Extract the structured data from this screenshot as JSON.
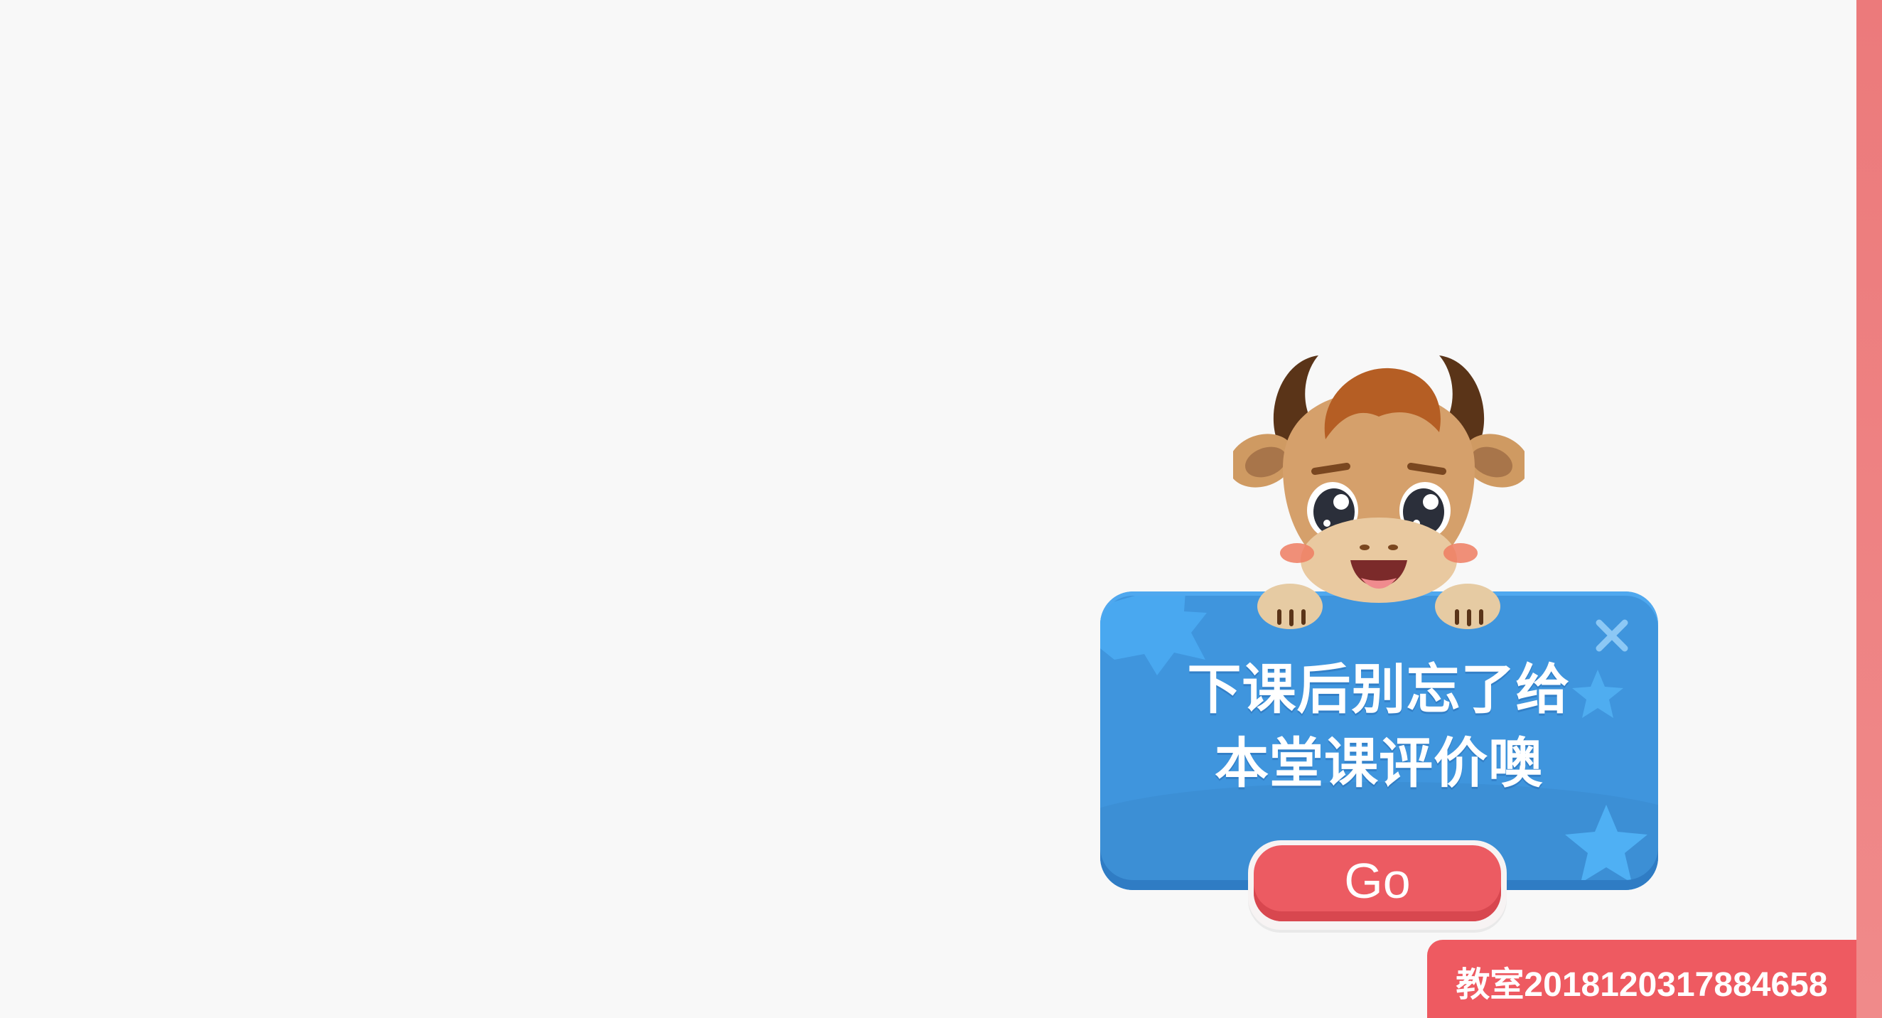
{
  "popup": {
    "message_line1": "下课后别忘了给",
    "message_line2": "本堂课评价噢",
    "go_label": "Go",
    "mascot_icon": "cartoon-bull-mascot",
    "close_icon": "close-x-icon"
  },
  "classroom": {
    "label": "教室2018120317884658"
  },
  "colors": {
    "background": "#f8f8f8",
    "card_blue": "#3f95dd",
    "go_red": "#ec5b62",
    "tag_red": "#ee5a61",
    "edge_pink": "#ec7a7b"
  }
}
